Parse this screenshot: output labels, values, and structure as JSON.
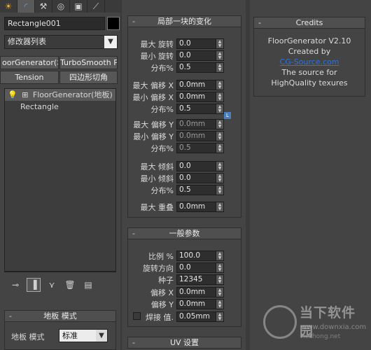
{
  "tabs": [
    {
      "name": "display-tab",
      "glyph": "☀"
    },
    {
      "name": "modify-tab",
      "glyph": "◜"
    },
    {
      "name": "hierarchy-tab",
      "glyph": "⚒"
    },
    {
      "name": "motion-tab",
      "glyph": "◎"
    },
    {
      "name": "utilities-tab",
      "glyph": "▣"
    },
    {
      "name": "create-tab",
      "glyph": "⟋"
    }
  ],
  "left": {
    "object_name": "Rectangle001",
    "object_color": "#000000",
    "modifier_list": "修改器列表",
    "buttons": {
      "floorgenerator": "oorGenerator(地板",
      "turbosmooth": "TurboSmooth Pro",
      "tension": "Tension",
      "quad_chamfer": "四边形切角"
    },
    "stack": [
      {
        "label": "FloorGenerator(地板)",
        "selected": true
      },
      {
        "label": "Rectangle",
        "selected": false
      }
    ],
    "floor_mode_rollout": {
      "title": "地板 模式",
      "label": "地板 模式",
      "value": "标准"
    }
  },
  "local_rollout": {
    "title": "局部一块的变化",
    "rows": [
      {
        "label": "最大 旋转",
        "value": "0.0"
      },
      {
        "label": "最小 旋转",
        "value": "0.0"
      },
      {
        "label": "分布%",
        "value": "0.5"
      },
      {
        "label": "最大 偏移 X",
        "value": "0.0mm"
      },
      {
        "label": "最小 偏移 X",
        "value": "0.0mm"
      },
      {
        "label": "分布%",
        "value": "0.5"
      },
      {
        "label": "最大 偏移 Y",
        "value": "0.0mm"
      },
      {
        "label": "最小 偏移 Y",
        "value": "0.0mm"
      },
      {
        "label": "分布%",
        "value": "0.5"
      },
      {
        "label": "最大 倾斜",
        "value": "0.0"
      },
      {
        "label": "最小 倾斜",
        "value": "0.0"
      },
      {
        "label": "分布%",
        "value": "0.5"
      },
      {
        "label": "最大 重叠",
        "value": "0.0mm"
      }
    ],
    "lock_label": "L"
  },
  "general_rollout": {
    "title": "一般参数",
    "rows": [
      {
        "label": "比例 %",
        "value": "100.0"
      },
      {
        "label": "旋转方向",
        "value": "0.0"
      },
      {
        "label": "种子",
        "value": "12345"
      },
      {
        "label": "偏移 X",
        "value": "0.0mm"
      },
      {
        "label": "偏移 Y",
        "value": "0.0mm"
      },
      {
        "label": "焊接 值.",
        "value": "0.05mm"
      }
    ]
  },
  "uv_rollout": {
    "title": "UV 设置"
  },
  "credits": {
    "title": "Credits",
    "product": "FloorGenerator V2.10",
    "created_by": "Created by",
    "link": "CG-Source.com",
    "source_line1": "The source for",
    "source_line2": "HighQuality texures"
  },
  "watermark": {
    "line1": "当下软件园",
    "line2": "www.downxia.com",
    "line3": "hezhong.net"
  }
}
